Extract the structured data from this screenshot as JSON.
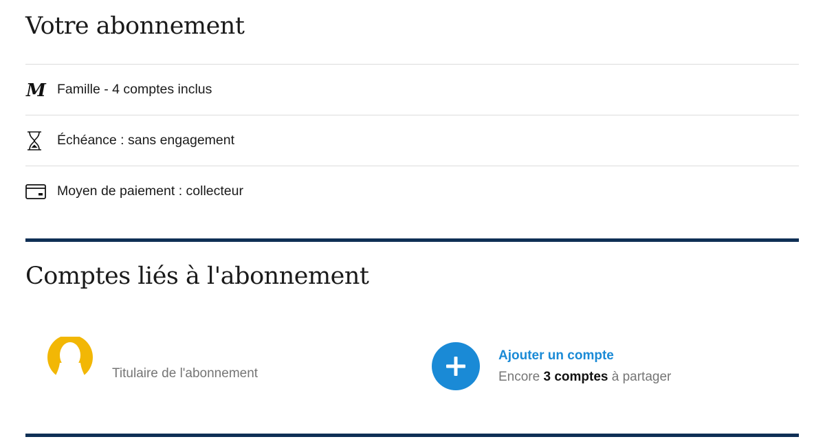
{
  "subscription": {
    "title": "Votre abonnement",
    "rows": [
      {
        "icon": "le-monde-logo-icon",
        "label": "Famille - 4 comptes inclus"
      },
      {
        "icon": "hourglass-icon",
        "label": "Échéance : sans engagement"
      },
      {
        "icon": "credit-card-icon",
        "label": "Moyen de paiement : collecteur"
      }
    ]
  },
  "accounts": {
    "title": "Comptes liés à l'abonnement",
    "owner": {
      "icon": "user-avatar-icon",
      "role": "Titulaire de l'abonnement"
    },
    "add": {
      "icon": "plus-icon",
      "label": "Ajouter un compte",
      "remaining_prefix": "Encore",
      "remaining_count": "3 comptes",
      "remaining_suffix": "à partager"
    }
  },
  "colors": {
    "accent": "#1a8ad6",
    "rule": "#0f2f55",
    "avatar": "#f2b705",
    "muted_text": "#757575"
  }
}
